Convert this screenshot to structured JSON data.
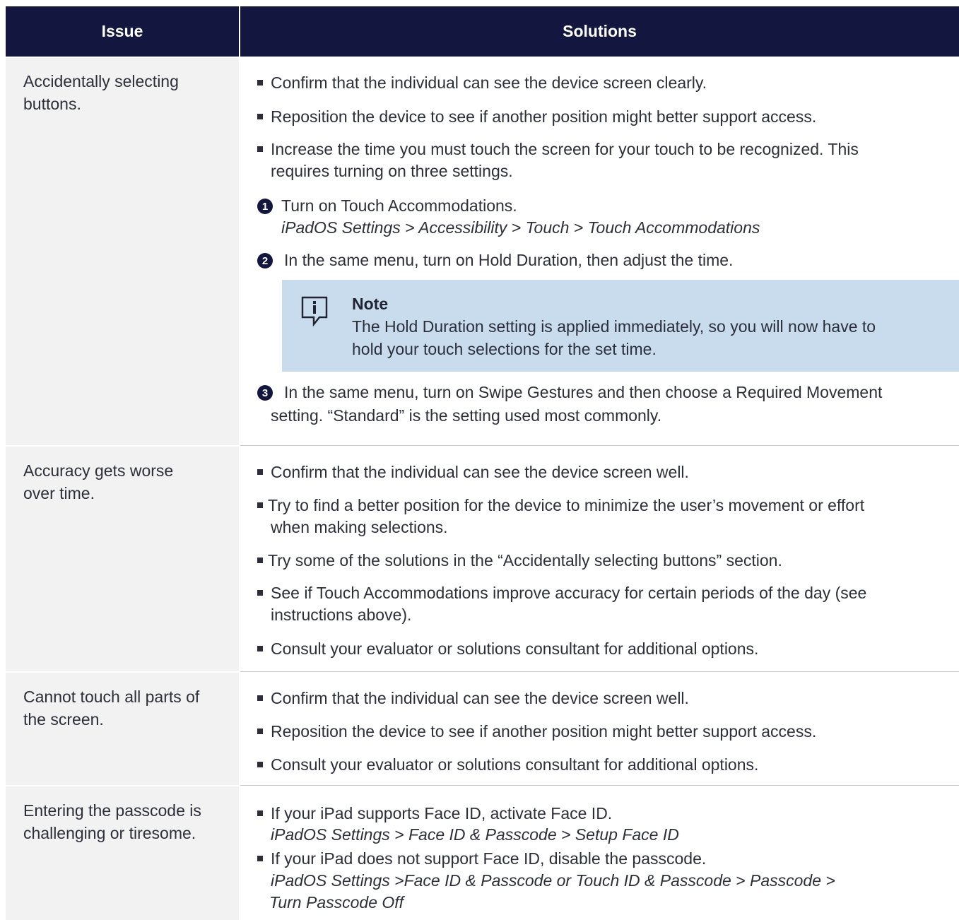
{
  "header": {
    "issue": "Issue",
    "solutions": "Solutions"
  },
  "rows": [
    {
      "issue": [
        "Accidentally selecting",
        "buttons."
      ],
      "bullets": [
        [
          "Confirm that the individual can see the device screen clearly."
        ],
        [
          "Reposition the device to see if another position might better support access."
        ],
        [
          "Increase the time you must touch the screen for your touch to be recognized.  This",
          "requires turning on three settings."
        ]
      ],
      "steps": [
        {
          "num": "1",
          "lines": [
            "Turn on Touch Accommodations."
          ],
          "path": "iPadOS Settings > Accessibility > Touch > Touch Accommodations"
        },
        {
          "num": "2",
          "lines": [
            "In the same menu, turn on Hold Duration, then adjust the time."
          ]
        },
        {
          "num": "3",
          "lines": [
            "In the same menu, turn on Swipe Gestures and then choose a Required Movement",
            "setting. “Standard” is the setting used most commonly."
          ]
        }
      ],
      "note": {
        "title": "Note",
        "lines": [
          "The Hold Duration setting is applied immediately, so you will now have to",
          "hold your touch selections for the set time."
        ]
      }
    },
    {
      "issue": [
        "Accuracy gets worse",
        "over time."
      ],
      "bullets": [
        [
          "Confirm that the individual can see the device screen well."
        ],
        [
          "Try to find a better position for the device to minimize the user’s movement or effort",
          "when making selections."
        ],
        [
          "Try some of the solutions in the “Accidentally selecting buttons” section."
        ],
        [
          "See if Touch Accommodations improve accuracy for certain periods of the day (see",
          "instructions above)."
        ],
        [
          "Consult your evaluator or solutions consultant for additional options."
        ]
      ]
    },
    {
      "issue": [
        "Cannot touch all parts of",
        "the screen."
      ],
      "bullets": [
        [
          "Confirm that the individual can see the device screen well."
        ],
        [
          "Reposition the device to see if another position might better support access."
        ],
        [
          "Consult your evaluator or solutions consultant for additional options."
        ]
      ]
    },
    {
      "issue": [
        "Entering the passcode is",
        "challenging or tiresome."
      ],
      "bullets": [
        [
          "If your iPad supports Face ID, activate Face ID."
        ],
        [
          "If your iPad does not support Face ID, disable the passcode."
        ]
      ],
      "paths": [
        "iPadOS Settings > Face ID & Passcode > Setup Face ID",
        "iPadOS Settings >Face ID & Passcode or Touch ID & Passcode > Passcode >",
        "Turn Passcode Off"
      ]
    }
  ]
}
